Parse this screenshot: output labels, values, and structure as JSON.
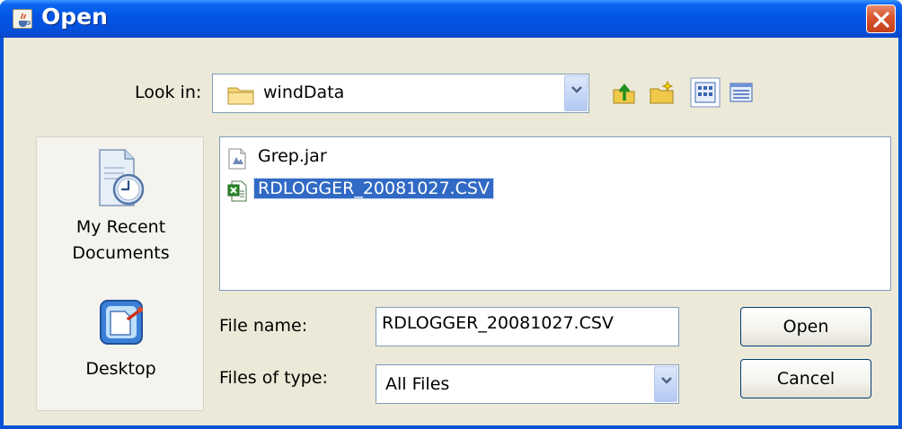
{
  "window": {
    "title": "Open"
  },
  "toolbar": {
    "look_in_label": "Look in:",
    "look_in_value": "windData",
    "icons": [
      "up-one-level-icon",
      "create-new-folder-icon",
      "list-view-icon",
      "details-view-icon"
    ]
  },
  "places": [
    {
      "label_line1": "My Recent",
      "label_line2": "Documents",
      "icon": "recent-documents-icon"
    },
    {
      "label": "Desktop",
      "icon": "desktop-icon"
    }
  ],
  "files": [
    {
      "name": "Grep.jar",
      "icon": "jar-file-icon",
      "selected": false
    },
    {
      "name": "RDLOGGER_20081027.CSV",
      "icon": "csv-file-icon",
      "selected": true
    }
  ],
  "form": {
    "file_name_label": "File name:",
    "file_name_value": "RDLOGGER_20081027.CSV",
    "file_type_label": "Files of type:",
    "file_type_value": "All Files"
  },
  "buttons": {
    "open": "Open",
    "cancel": "Cancel"
  },
  "colors": {
    "title_bar": "#0254e3",
    "selection": "#316ac5",
    "dialog_bg": "#ece9d8",
    "close_button": "#d8542c"
  }
}
